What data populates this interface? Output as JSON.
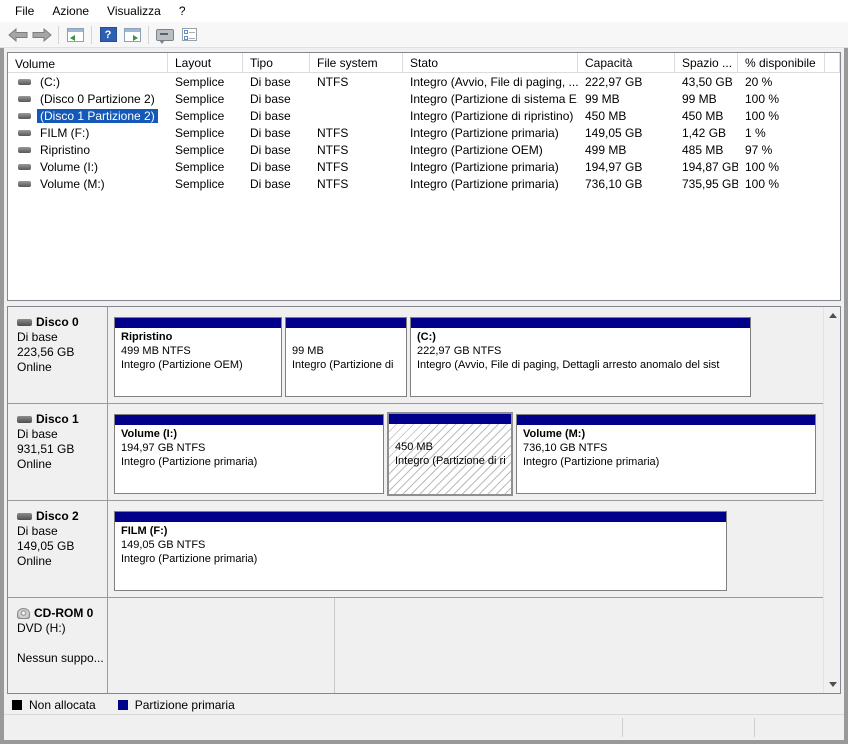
{
  "menu": {
    "items": [
      {
        "label": "File"
      },
      {
        "label": "Azione"
      },
      {
        "label": "Visualizza"
      },
      {
        "label": "?"
      }
    ]
  },
  "toolbar": {
    "icons": [
      {
        "name": "back"
      },
      {
        "name": "forward"
      },
      {
        "name": "show-console-tree"
      },
      {
        "name": "help"
      },
      {
        "name": "show-action-pane"
      },
      {
        "name": "screen-tip"
      },
      {
        "name": "customize-view"
      }
    ],
    "help_glyph": "?"
  },
  "volume_table": {
    "columns": [
      {
        "label": "Volume"
      },
      {
        "label": "Layout"
      },
      {
        "label": "Tipo"
      },
      {
        "label": "File system"
      },
      {
        "label": "Stato"
      },
      {
        "label": "Capacità"
      },
      {
        "label": "Spazio ..."
      },
      {
        "label": "% disponibile"
      }
    ],
    "rows": [
      {
        "name": "(C:)",
        "layout": "Semplice",
        "tipo": "Di base",
        "fs": "NTFS",
        "stato": "Integro (Avvio, File di paging, ...",
        "capacita": "222,97 GB",
        "spazio": "43,50 GB",
        "disponibile": "20 %"
      },
      {
        "name": "(Disco 0 Partizione 2)",
        "layout": "Semplice",
        "tipo": "Di base",
        "fs": "",
        "stato": "Integro (Partizione di sistema E...",
        "capacita": "99 MB",
        "spazio": "99 MB",
        "disponibile": "100 %"
      },
      {
        "name": "(Disco 1 Partizione 2)",
        "layout": "Semplice",
        "tipo": "Di base",
        "fs": "",
        "stato": "Integro (Partizione di ripristino)",
        "capacita": "450 MB",
        "spazio": "450 MB",
        "disponibile": "100 %"
      },
      {
        "name": "FILM (F:)",
        "layout": "Semplice",
        "tipo": "Di base",
        "fs": "NTFS",
        "stato": "Integro (Partizione primaria)",
        "capacita": "149,05 GB",
        "spazio": "1,42 GB",
        "disponibile": "1 %"
      },
      {
        "name": "Ripristino",
        "layout": "Semplice",
        "tipo": "Di base",
        "fs": "NTFS",
        "stato": "Integro (Partizione OEM)",
        "capacita": "499 MB",
        "spazio": "485 MB",
        "disponibile": "97 %"
      },
      {
        "name": "Volume (I:)",
        "layout": "Semplice",
        "tipo": "Di base",
        "fs": "NTFS",
        "stato": "Integro (Partizione primaria)",
        "capacita": "194,97 GB",
        "spazio": "194,87 GB",
        "disponibile": "100 %"
      },
      {
        "name": "Volume (M:)",
        "layout": "Semplice",
        "tipo": "Di base",
        "fs": "NTFS",
        "stato": "Integro (Partizione primaria)",
        "capacita": "736,10 GB",
        "spazio": "735,95 GB",
        "disponibile": "100 %"
      }
    ],
    "selected_row": "(Disco 1 Partizione 2)"
  },
  "graphical_view": {
    "disks": [
      {
        "title": "Disco 0",
        "subtitle": "Di base",
        "size": "223,56 GB",
        "status": "Online",
        "icon": "disk",
        "partitions": [
          {
            "name": "Ripristino",
            "size": "499 MB NTFS",
            "status": "Integro (Partizione OEM)"
          },
          {
            "name": "",
            "size": "99 MB",
            "status": "Integro (Partizione di"
          },
          {
            "name": "(C:)",
            "size": "222,97 GB NTFS",
            "status": "Integro (Avvio, File di paging, Dettagli arresto anomalo del sist"
          }
        ]
      },
      {
        "title": "Disco 1",
        "subtitle": "Di base",
        "size": "931,51 GB",
        "status": "Online",
        "icon": "disk",
        "partitions": [
          {
            "name": "Volume  (I:)",
            "size": "194,97 GB NTFS",
            "status": "Integro (Partizione primaria)"
          },
          {
            "name": "",
            "size": "450 MB",
            "status": "Integro (Partizione di ri"
          },
          {
            "name": "Volume  (M:)",
            "size": "736,10 GB NTFS",
            "status": "Integro (Partizione primaria)"
          }
        ]
      },
      {
        "title": "Disco 2",
        "subtitle": "Di base",
        "size": "149,05 GB",
        "status": "Online",
        "icon": "disk",
        "partitions": [
          {
            "name": "FILM  (F:)",
            "size": "149,05 GB NTFS",
            "status": "Integro (Partizione primaria)"
          }
        ]
      },
      {
        "title": "CD-ROM 0",
        "subtitle": "DVD (H:)",
        "size": "",
        "status": "Nessun suppo...",
        "icon": "cd",
        "partitions": []
      }
    ]
  },
  "legend": {
    "items": [
      {
        "label": "Non allocata",
        "color": "#000000"
      },
      {
        "label": "Partizione primaria",
        "color": "#00008b"
      }
    ]
  },
  "colors": {
    "selection": "#1458b8",
    "partition_primary": "#00008b"
  }
}
